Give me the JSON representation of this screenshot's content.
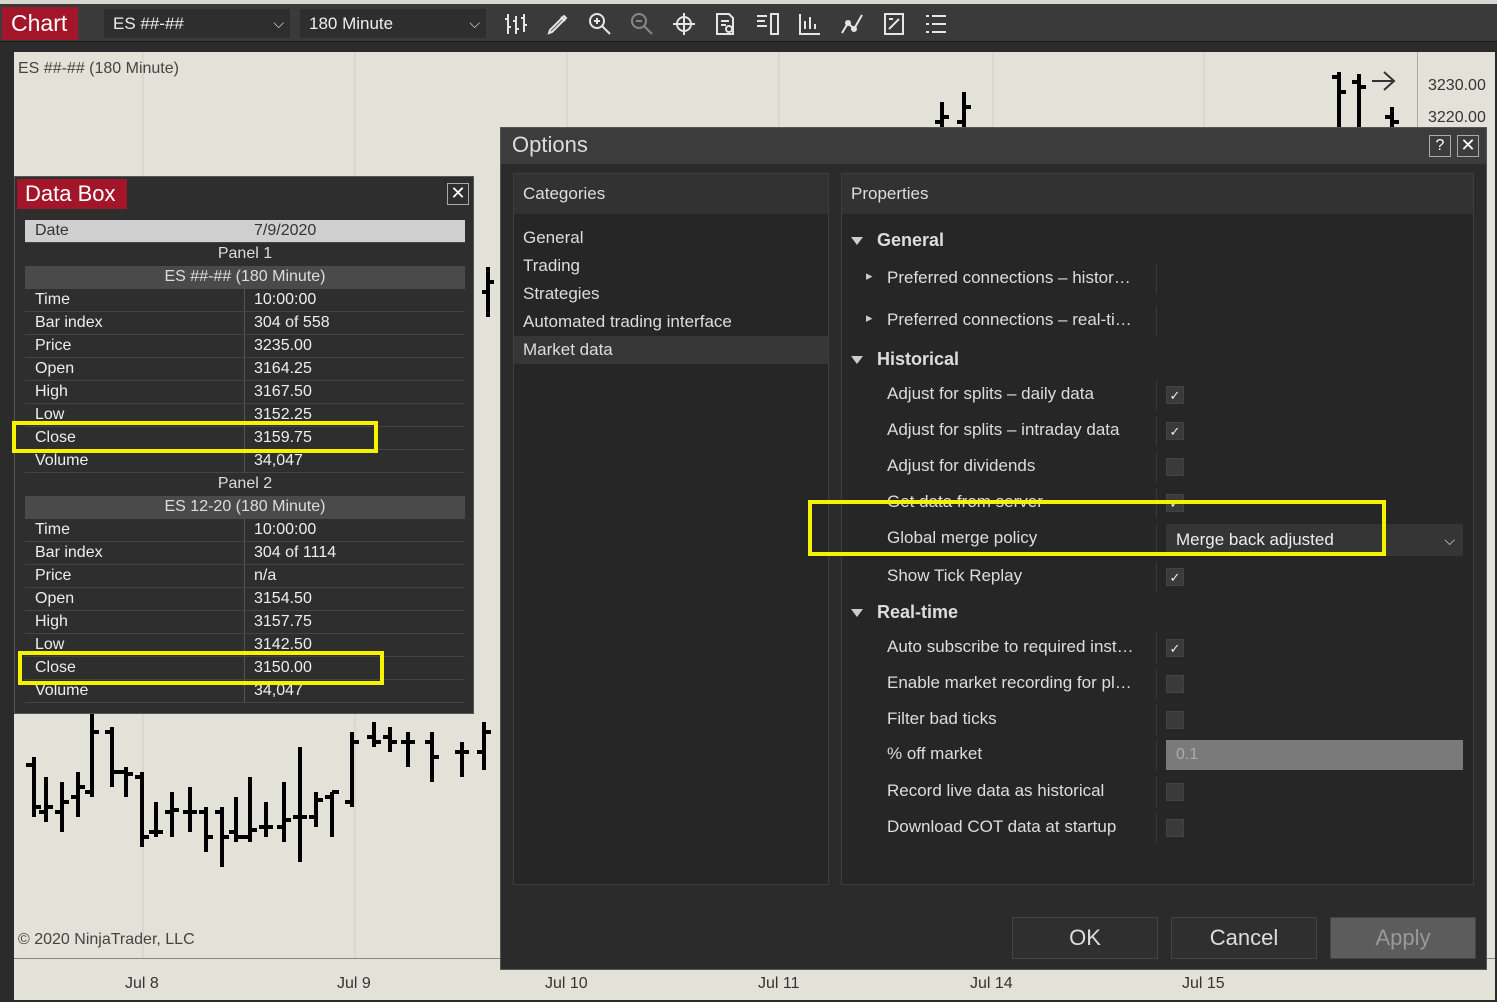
{
  "toolbar": {
    "tab_label": "Chart",
    "instrument": "ES ##-##",
    "interval": "180 Minute",
    "icons": [
      "bars-type-icon",
      "drawing-tool-icon",
      "zoom-in-icon",
      "zoom-out-icon",
      "crosshair-icon",
      "data-box-icon",
      "chart-trader-icon",
      "indicators-icon",
      "strategies-icon",
      "properties-icon",
      "templates-icon"
    ]
  },
  "chart": {
    "title": "ES ##-## (180 Minute)",
    "copyright": "© 2020 NinjaTrader, LLC",
    "price_labels": [
      "3230.00",
      "3220.00"
    ],
    "time_labels": [
      "Jul 8",
      "Jul 9",
      "Jul 10",
      "Jul 11",
      "Jul 14",
      "Jul 15"
    ]
  },
  "databox": {
    "title": "Data Box",
    "close": "✕",
    "date_label": "Date",
    "date_value": "7/9/2020",
    "panels": [
      {
        "panel_label": "Panel 1",
        "series": "ES ##-## (180 Minute)",
        "rows": [
          {
            "k": "Time",
            "v": "10:00:00"
          },
          {
            "k": "Bar index",
            "v": "304 of 558"
          },
          {
            "k": "Price",
            "v": "3235.00"
          },
          {
            "k": "Open",
            "v": "3164.25"
          },
          {
            "k": "High",
            "v": "3167.50"
          },
          {
            "k": "Low",
            "v": "3152.25"
          },
          {
            "k": "Close",
            "v": "3159.75"
          },
          {
            "k": "Volume",
            "v": "34,047"
          }
        ]
      },
      {
        "panel_label": "Panel 2",
        "series": "ES 12-20 (180 Minute)",
        "rows": [
          {
            "k": "Time",
            "v": "10:00:00"
          },
          {
            "k": "Bar index",
            "v": "304 of 1114"
          },
          {
            "k": "Price",
            "v": "n/a"
          },
          {
            "k": "Open",
            "v": "3154.50"
          },
          {
            "k": "High",
            "v": "3157.75"
          },
          {
            "k": "Low",
            "v": "3142.50"
          },
          {
            "k": "Close",
            "v": "3150.00"
          },
          {
            "k": "Volume",
            "v": "34,047"
          }
        ]
      }
    ]
  },
  "options": {
    "title": "Options",
    "help": "?",
    "close": "✕",
    "categories_header": "Categories",
    "categories": [
      "General",
      "Trading",
      "Strategies",
      "Automated trading interface",
      "Market data"
    ],
    "selected_category": "Market data",
    "properties_header": "Properties",
    "groups": {
      "general": "General",
      "historical": "Historical",
      "realtime": "Real-time"
    },
    "general_rows": [
      "Preferred connections – histor…",
      "Preferred connections – real-ti…"
    ],
    "historical_rows": [
      {
        "label": "Adjust for splits – daily data",
        "checked": true
      },
      {
        "label": "Adjust for splits – intraday data",
        "checked": true
      },
      {
        "label": "Adjust for dividends",
        "checked": false
      },
      {
        "label": "Get data from server",
        "checked": true
      },
      {
        "label": "Global merge policy",
        "value": "Merge back adjusted"
      },
      {
        "label": "Show Tick Replay",
        "checked": true
      }
    ],
    "realtime_rows": [
      {
        "label": "Auto subscribe to required inst…",
        "checked": true
      },
      {
        "label": "Enable market recording for pl…",
        "checked": false
      },
      {
        "label": "Filter bad ticks",
        "checked": false
      },
      {
        "label": "% off market",
        "value": "0.1"
      },
      {
        "label": "Record live data as historical",
        "checked": false
      },
      {
        "label": "Download COT data at startup",
        "checked": false
      }
    ],
    "check_glyph": "✓",
    "buttons": {
      "ok": "OK",
      "cancel": "Cancel",
      "apply": "Apply"
    }
  }
}
